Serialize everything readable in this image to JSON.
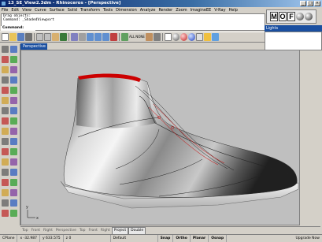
{
  "window": {
    "title": "13_SE_View2.3dm - Rhinoceros - [Perspective]",
    "controls": [
      "_",
      "□",
      "×"
    ]
  },
  "menu": [
    "File",
    "Edit",
    "View",
    "Curve",
    "Surface",
    "Solid",
    "Transform",
    "Tools",
    "Dimension",
    "Analyze",
    "Render",
    "Zoom",
    "ImagineEE",
    "V-Ray",
    "Help"
  ],
  "command": {
    "history": [
      "Drag objects:",
      "Command: _ShadedViewport"
    ],
    "prompt": "Command:"
  },
  "toolbar": {
    "all_label": "ALL",
    "none_label": "NONE"
  },
  "viewport": {
    "tab_label": "Perspective",
    "axis_x": "x",
    "axis_y": "y"
  },
  "side_panel": {
    "mof_letters": [
      "M",
      "O",
      "F"
    ],
    "lights_title": "Lights"
  },
  "bottom_tabs": [
    "Top",
    "Front",
    "Right",
    "Perspective",
    "Top",
    "Front",
    "Right",
    "Project",
    "Double"
  ],
  "status": {
    "cplane": "CPlane",
    "x": "x -32.987",
    "y": "y 633.575",
    "z": "z 0",
    "layer": "Default",
    "snap": "Snap",
    "ortho": "Ortho",
    "planar": "Planar",
    "osnap": "Osnap",
    "right_text": "Upgrade Now"
  },
  "colors": {
    "titlebar": "#0a246a",
    "viewport_bg": "#bfbfbf",
    "shoe_rim": "#cc0000",
    "tab_active": "#1a4fa0"
  }
}
